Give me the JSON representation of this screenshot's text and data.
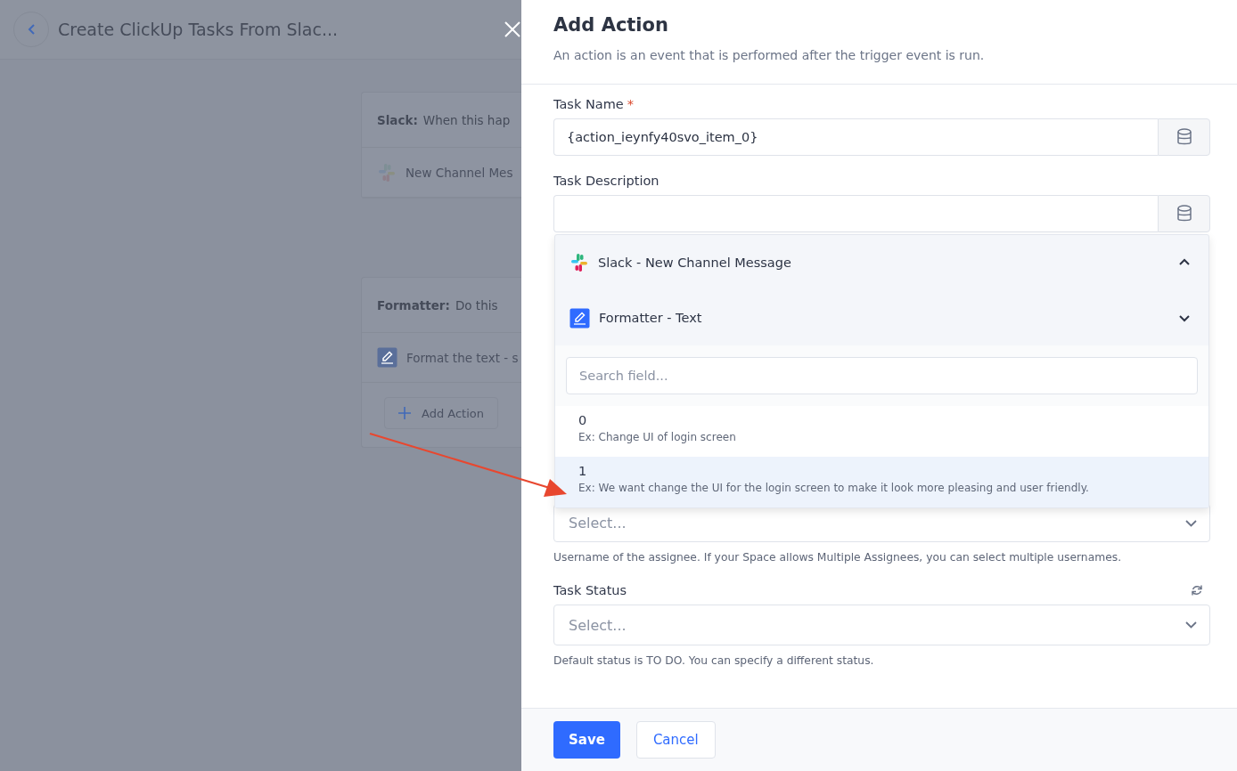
{
  "background": {
    "title": "Create ClickUp Tasks From Slac...",
    "cards": [
      {
        "app": "Slack:",
        "caption": "When this hap",
        "step": {
          "kind": "slack",
          "text": "New Channel Mes"
        }
      },
      {
        "app": "Formatter:",
        "caption": "Do this",
        "step": {
          "kind": "formatter",
          "text": "Format the text - s"
        },
        "add_button": "Add Action"
      }
    ]
  },
  "drawer": {
    "title": "Add Action",
    "subtitle": "An action is an event that is performed after the trigger event is run.",
    "fields": [
      {
        "label": "Task Name",
        "required_mark": "*",
        "value": "{action_ieynfy40svo_item_0}"
      },
      {
        "label": "Task Description"
      }
    ],
    "picker": {
      "groups": [
        {
          "kind": "slack",
          "label": "Slack - New Channel Message",
          "expanded": true
        },
        {
          "kind": "formatter",
          "label": "Formatter - Text",
          "expanded": false
        }
      ],
      "search": {
        "placeholder": "Search field..."
      },
      "options": [
        {
          "name": "0",
          "example": "Ex: Change UI of login screen",
          "selected": false
        },
        {
          "name": "1",
          "example": "Ex: We want change the UI for the login screen to make it look more pleasing and user friendly.",
          "selected": true
        }
      ]
    },
    "selects": [
      {
        "placeholder": "Select...",
        "hint": "Username of the assignee. If your Space allows Multiple Assignees, you can select multiple usernames."
      },
      {
        "label": "Task Status",
        "placeholder": "Select...",
        "hint": "Default status is TO DO. You can specify a different status.",
        "refresh": true
      }
    ],
    "buttons": [
      {
        "kind": "primary",
        "label": "Save"
      },
      {
        "kind": "secondary",
        "label": "Cancel"
      }
    ]
  }
}
